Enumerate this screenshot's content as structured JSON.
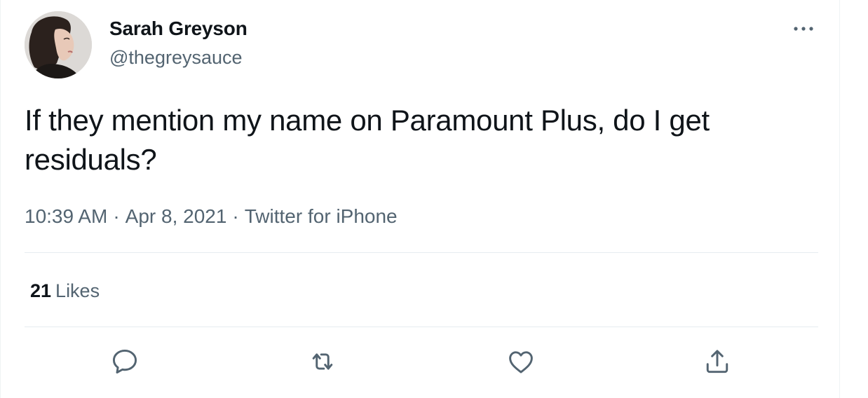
{
  "tweet": {
    "author": {
      "display_name": "Sarah Greyson",
      "handle": "@thegreysauce"
    },
    "text": "If they mention my name on Paramount Plus, do I get residuals?",
    "meta": {
      "time": "10:39 AM",
      "separator": "·",
      "date": "Apr 8, 2021",
      "source": "Twitter for iPhone"
    },
    "stats": {
      "likes_count": "21",
      "likes_label": "Likes"
    },
    "actions": [
      {
        "icon": "reply-icon"
      },
      {
        "icon": "retweet-icon"
      },
      {
        "icon": "like-icon"
      },
      {
        "icon": "share-icon"
      }
    ],
    "colors": {
      "text_primary": "#0f1419",
      "text_secondary": "#536471",
      "divider": "#e6ecf0"
    }
  }
}
